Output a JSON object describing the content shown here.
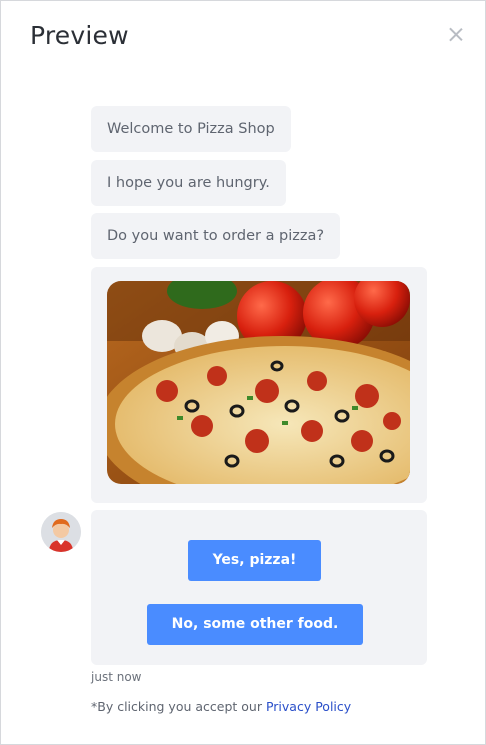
{
  "header": {
    "title": "Preview",
    "close_icon": "close-icon"
  },
  "messages": [
    {
      "text": "Welcome to Pizza Shop"
    },
    {
      "text": "I hope you are hungry."
    },
    {
      "text": "Do you want to order a pizza?"
    }
  ],
  "image": {
    "alt": "pizza"
  },
  "buttons": {
    "yes": "Yes, pizza!",
    "no": "No, some other food."
  },
  "timestamp": "just now",
  "consent": {
    "prefix": "*By clicking you accept our ",
    "link": "Privacy Policy"
  },
  "colors": {
    "accent": "#4a8cff",
    "bubble": "#f2f3f6",
    "link": "#2a4fc9"
  }
}
